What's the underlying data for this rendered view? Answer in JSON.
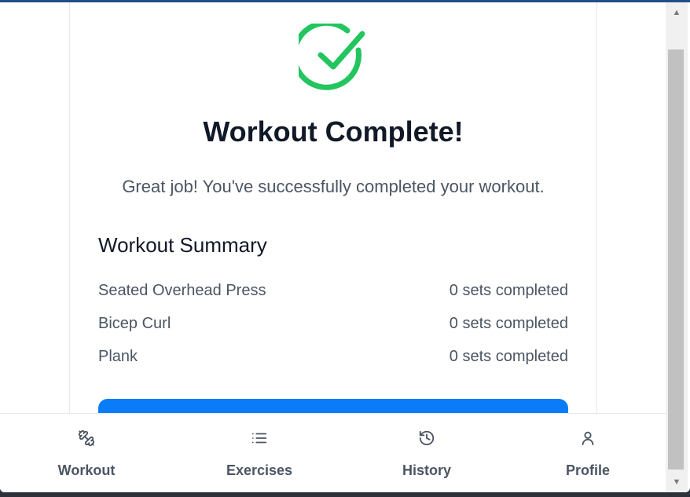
{
  "complete": {
    "icon": "check-circle-icon",
    "title": "Workout Complete!",
    "message": "Great job! You've successfully completed your workout.",
    "accent_color": "#22c55e"
  },
  "summary": {
    "heading": "Workout Summary",
    "items": [
      {
        "exercise": "Seated Overhead Press",
        "status": "0 sets completed"
      },
      {
        "exercise": "Bicep Curl",
        "status": "0 sets completed"
      },
      {
        "exercise": "Plank",
        "status": "0 sets completed"
      }
    ]
  },
  "primary_button_color": "#0a7cf8",
  "bottom_nav": {
    "items": [
      {
        "label": "Workout",
        "icon": "dumbbell-icon"
      },
      {
        "label": "Exercises",
        "icon": "list-icon"
      },
      {
        "label": "History",
        "icon": "history-icon"
      },
      {
        "label": "Profile",
        "icon": "user-icon"
      }
    ]
  }
}
